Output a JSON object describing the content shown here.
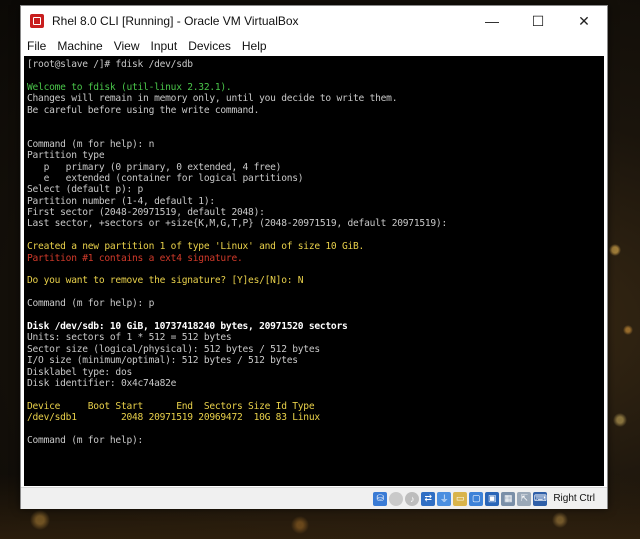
{
  "window": {
    "title": "Rhel 8.0 CLI [Running] - Oracle VM VirtualBox",
    "controls": {
      "minimize": "—",
      "maximize": "☐",
      "close": "✕"
    }
  },
  "menu": [
    "File",
    "Machine",
    "View",
    "Input",
    "Devices",
    "Help"
  ],
  "terminal": {
    "lines": [
      {
        "text": "[root@slave /]# fdisk /dev/sdb",
        "color": "gray"
      },
      {
        "text": "",
        "color": "gray"
      },
      {
        "text": "Welcome to fdisk (util-linux 2.32.1).",
        "color": "green"
      },
      {
        "text": "Changes will remain in memory only, until you decide to write them.",
        "color": "gray"
      },
      {
        "text": "Be careful before using the write command.",
        "color": "gray"
      },
      {
        "text": "",
        "color": "gray"
      },
      {
        "text": "",
        "color": "gray"
      },
      {
        "text": "Command (m for help): n",
        "color": "gray"
      },
      {
        "text": "Partition type",
        "color": "gray"
      },
      {
        "text": "   p   primary (0 primary, 0 extended, 4 free)",
        "color": "gray"
      },
      {
        "text": "   e   extended (container for logical partitions)",
        "color": "gray"
      },
      {
        "text": "Select (default p): p",
        "color": "gray"
      },
      {
        "text": "Partition number (1-4, default 1):",
        "color": "gray"
      },
      {
        "text": "First sector (2048-20971519, default 2048):",
        "color": "gray"
      },
      {
        "text": "Last sector, +sectors or +size{K,M,G,T,P} (2048-20971519, default 20971519):",
        "color": "gray"
      },
      {
        "text": "",
        "color": "gray"
      },
      {
        "text": "Created a new partition 1 of type 'Linux' and of size 10 GiB.",
        "color": "yellow"
      },
      {
        "text": "Partition #1 contains a ext4 signature.",
        "color": "red"
      },
      {
        "text": "",
        "color": "gray"
      },
      {
        "text": "Do you want to remove the signature? [Y]es/[N]o: N",
        "color": "yellow"
      },
      {
        "text": "",
        "color": "gray"
      },
      {
        "text": "Command (m for help): p",
        "color": "gray"
      },
      {
        "text": "",
        "color": "gray"
      },
      {
        "text": "Disk /dev/sdb: 10 GiB, 10737418240 bytes, 20971520 sectors",
        "color": "white"
      },
      {
        "text": "Units: sectors of 1 * 512 = 512 bytes",
        "color": "gray"
      },
      {
        "text": "Sector size (logical/physical): 512 bytes / 512 bytes",
        "color": "gray"
      },
      {
        "text": "I/O size (minimum/optimal): 512 bytes / 512 bytes",
        "color": "gray"
      },
      {
        "text": "Disklabel type: dos",
        "color": "gray"
      },
      {
        "text": "Disk identifier: 0x4c74a82e",
        "color": "gray"
      },
      {
        "text": "",
        "color": "gray"
      },
      {
        "text": "Device     Boot Start      End  Sectors Size Id Type",
        "color": "yellow"
      },
      {
        "text": "/dev/sdb1        2048 20971519 20969472  10G 83 Linux",
        "color": "yellow"
      },
      {
        "text": "",
        "color": "gray"
      },
      {
        "text": "Command (m for help):",
        "color": "gray"
      }
    ]
  },
  "statusbar": {
    "icons": [
      "harddisk-icon",
      "optical-drive-icon",
      "audio-icon",
      "network-icon",
      "usb-icon",
      "shared-folder-icon",
      "display-icon",
      "video-capture-icon",
      "cpu-icon",
      "mouse-integration-icon",
      "keyboard-icon"
    ],
    "host_key": "Right Ctrl"
  },
  "colors": {
    "gray": "#c8c8c8",
    "white": "#ffffff",
    "green": "#49c449",
    "yellow": "#e8d04a",
    "red": "#d23a2a"
  }
}
